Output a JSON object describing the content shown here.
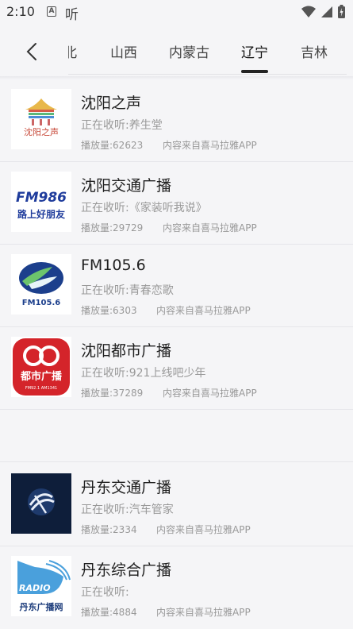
{
  "status_bar": {
    "time": "2:10",
    "a_icon": "A",
    "app_icon_text": "听"
  },
  "tabs": [
    {
      "label": "北",
      "active": false
    },
    {
      "label": "山西",
      "active": false
    },
    {
      "label": "内蒙古",
      "active": false
    },
    {
      "label": "辽宁",
      "active": true
    },
    {
      "label": "吉林",
      "active": false
    }
  ],
  "stations": [
    {
      "name": "沈阳之声",
      "listening": "正在收听:养生堂",
      "plays": "播放量:62623",
      "source": "内容来自喜马拉雅APP",
      "logo": "shenyang-zhisheng-logo",
      "logo_text": "沈阳之声"
    },
    {
      "name": "沈阳交通广播",
      "listening": "正在收听:《家装听我说》",
      "plays": "播放量:29729",
      "source": "内容来自喜马拉雅APP",
      "logo": "fm986-logo",
      "logo_text": "FM986",
      "logo_subtext": "路上好朋友"
    },
    {
      "name": "FM105.6",
      "listening": "正在收听:青春恋歌",
      "plays": "播放量:6303",
      "source": "内容来自喜马拉雅APP",
      "logo": "fm1056-logo",
      "logo_text": "FM105.6"
    },
    {
      "name": "沈阳都市广播",
      "listening": "正在收听:921上线吧少年",
      "plays": "播放量:37289",
      "source": "内容来自喜马拉雅APP",
      "logo": "dushi-logo",
      "logo_text": "都市广播",
      "logo_subtext": "FM92.1 AM1341"
    },
    {
      "name": "丹东交通广播",
      "listening": "正在收听:汽车管家",
      "plays": "播放量:2334",
      "source": "内容来自喜马拉雅APP",
      "logo": "dandong-jiaotong-logo"
    },
    {
      "name": "丹东综合广播",
      "listening": "正在收听:",
      "plays": "播放量:4884",
      "source": "内容来自喜马拉雅APP",
      "logo": "dandong-zonghe-logo",
      "logo_text": "RADIO",
      "logo_subtext": "丹东广播网"
    }
  ]
}
